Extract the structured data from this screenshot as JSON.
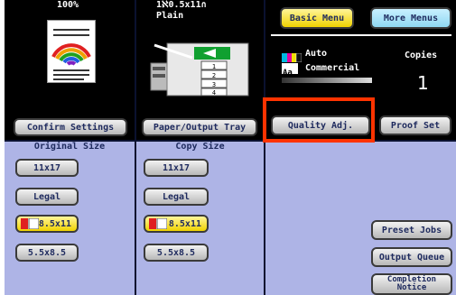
{
  "original": {
    "zoom": "100%"
  },
  "output": {
    "summary": "1ℵ0.5x11∩",
    "paper_type": "Plain"
  },
  "tabs": {
    "basic": "Basic Menu",
    "more": "More Menus"
  },
  "mode": {
    "color": "Auto",
    "image_type": "Commercial"
  },
  "copies": {
    "label": "Copies",
    "value": "1"
  },
  "buttons": {
    "confirm": "Confirm Settings",
    "paper_tray": "Paper/Output Tray",
    "quality": "Quality Adj.",
    "proof": "Proof Set",
    "preset": "Preset Jobs",
    "queue": "Output Queue",
    "completion": "Completion Notice"
  },
  "original_size": {
    "header": "Original Size",
    "items": [
      "11x17",
      "Legal",
      "8.5x11",
      "5.5x8.5"
    ]
  },
  "copy_size": {
    "header": "Copy Size",
    "items": [
      "11x17",
      "Legal",
      "8.5x11",
      "5.5x8.5"
    ]
  },
  "colors": {
    "highlight_box": "#ff3300",
    "selected_button": "#f0d200",
    "panel": "#aeb4e6"
  }
}
